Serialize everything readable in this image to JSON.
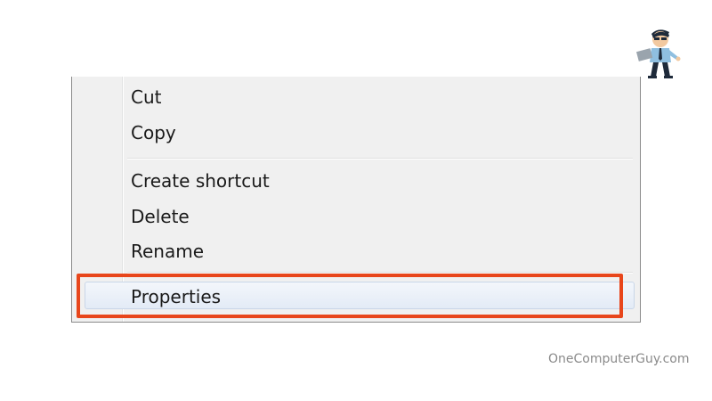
{
  "context_menu": {
    "items": [
      {
        "label": "Cut"
      },
      {
        "label": "Copy"
      },
      {
        "label": "Create shortcut"
      },
      {
        "label": "Delete"
      },
      {
        "label": "Rename"
      },
      {
        "label": "Properties",
        "highlighted": true
      }
    ]
  },
  "callout": {
    "color": "#e8461b",
    "target": "Properties"
  },
  "logo": {
    "icon": "computer-guy-mascot-icon"
  },
  "watermark": {
    "text": "OneComputerGuy.com"
  }
}
